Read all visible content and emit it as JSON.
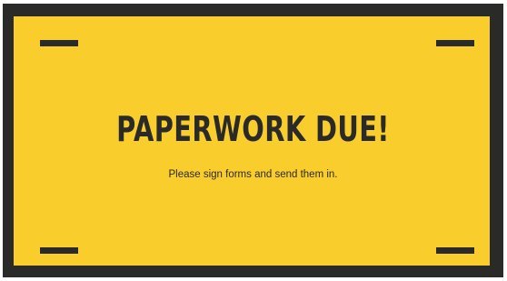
{
  "notice": {
    "headline": "PAPERWORK DUE!",
    "subtitle": "Please sign forms and send them in."
  },
  "colors": {
    "background": "#f9cd2b",
    "border": "#2a2a28",
    "text": "#2a2a28"
  }
}
